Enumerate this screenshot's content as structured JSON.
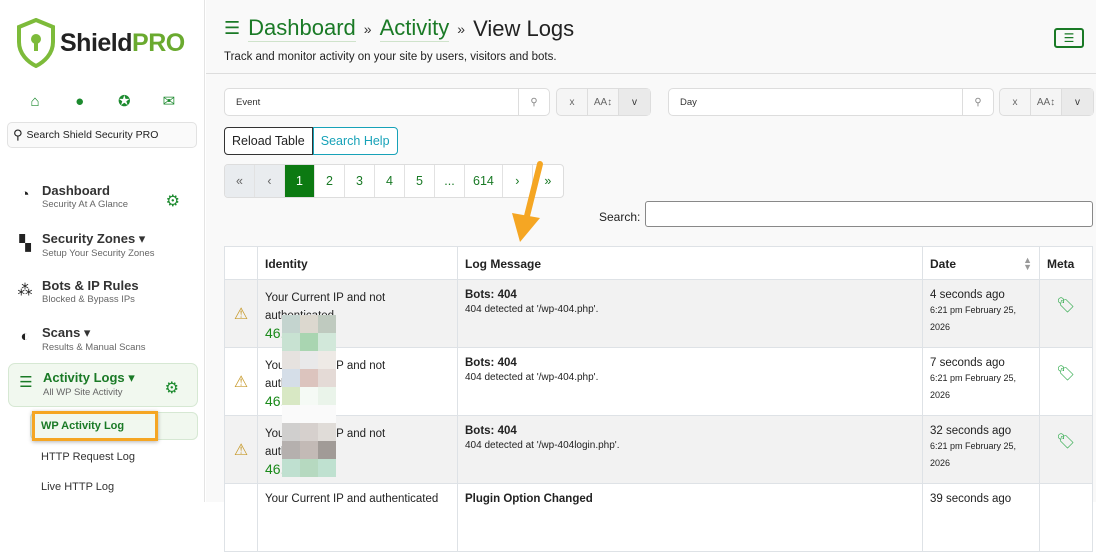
{
  "brand": {
    "name_a": "Shield",
    "name_b": "PRO"
  },
  "sidebar": {
    "search_placeholder": "Search Shield Security PRO",
    "social": [
      "home-icon",
      "facebook-icon",
      "support-icon",
      "email-icon"
    ],
    "items": [
      {
        "label": "Dashboard",
        "sub": "Security At A Glance"
      },
      {
        "label": "Security Zones ▾",
        "sub": "Setup Your Security Zones"
      },
      {
        "label": "Bots & IP Rules",
        "sub": "Blocked & Bypass IPs"
      },
      {
        "label": "Scans ▾",
        "sub": "Results & Manual Scans"
      },
      {
        "label": "Activity Logs ▾",
        "sub": "All WP Site Activity"
      }
    ],
    "subitems": [
      "WP Activity Log",
      "HTTP Request Log",
      "Live HTTP Log"
    ]
  },
  "header": {
    "crumbs": [
      "Dashboard",
      "Activity"
    ],
    "current": "View Logs",
    "sep": "»",
    "subtitle": "Track and monitor activity on your site by users, visitors and bots."
  },
  "filters": {
    "event": "Event",
    "day": "Day",
    "clear": "x",
    "case": "AA↕",
    "toggle": "v"
  },
  "buttons": {
    "reload": "Reload Table",
    "help": "Search Help"
  },
  "pagination": [
    "«",
    "‹",
    "1",
    "2",
    "3",
    "4",
    "5",
    "...",
    "614",
    "›",
    "»"
  ],
  "search_label": "Search:",
  "table": {
    "headers": [
      "Identity",
      "Log Message",
      "Date",
      "Meta"
    ],
    "rows": [
      {
        "identity": "Your Current IP and not authenticated",
        "ip": "46.",
        "title": "Bots: 404",
        "detail": "404 detected at '/wp-404.php'.",
        "ago": "4 seconds ago",
        "date": "6:21 pm February 25, 2026"
      },
      {
        "identity": "Your Current IP and not authenticated",
        "ip": "46.",
        "title": "Bots: 404",
        "detail": "404 detected at '/wp-404.php'.",
        "ago": "7 seconds ago",
        "date": "6:21 pm February 25, 2026"
      },
      {
        "identity": "Your Current IP and not authenticated",
        "ip": "46.",
        "title": "Bots: 404",
        "detail": "404 detected at '/wp-404login.php'.",
        "ago": "32 seconds ago",
        "date": "6:21 pm February 25, 2026"
      },
      {
        "identity": "Your Current IP and authenticated",
        "ip": "",
        "title": "Plugin Option Changed",
        "detail": "",
        "ago": "39 seconds ago",
        "date": ""
      }
    ]
  },
  "colors": {
    "brand": "#1a7a26",
    "highlight": "#f5a623"
  }
}
